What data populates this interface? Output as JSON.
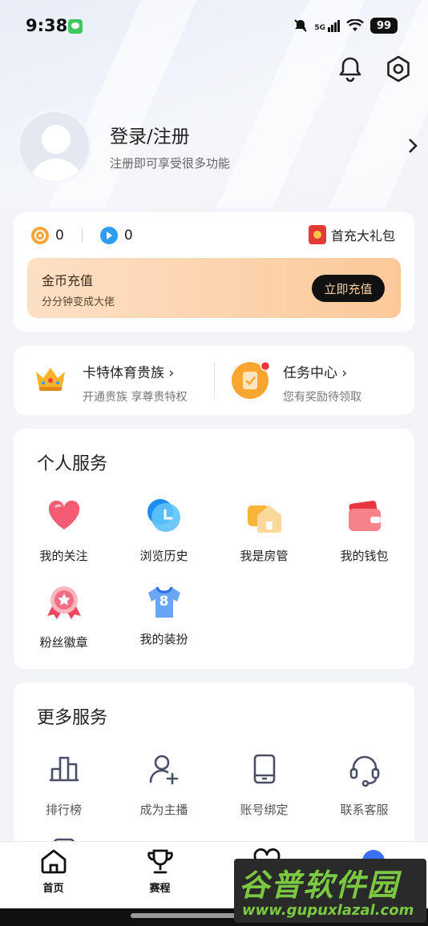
{
  "status_bar": {
    "time": "9:38",
    "network": "5G",
    "battery": "99"
  },
  "profile": {
    "title": "登录/注册",
    "subtitle": "注册即可享受很多功能"
  },
  "wallet": {
    "coin1_value": "0",
    "coin2_value": "0",
    "gift_label": "首充大礼包",
    "recharge_title": "金币充值",
    "recharge_sub": "分分钟变成大佬",
    "recharge_button": "立即充值"
  },
  "promo": {
    "noble_title": "卡特体育贵族 ›",
    "noble_sub": "开通贵族 享尊贵特权",
    "task_title": "任务中心 ›",
    "task_sub": "您有奖励待领取"
  },
  "personal_services": {
    "title": "个人服务",
    "items": [
      {
        "label": "我的关注",
        "icon": "heart-icon"
      },
      {
        "label": "浏览历史",
        "icon": "clock-icon"
      },
      {
        "label": "我是房管",
        "icon": "house-icon"
      },
      {
        "label": "我的钱包",
        "icon": "wallet-icon"
      },
      {
        "label": "粉丝徽章",
        "icon": "badge-icon"
      },
      {
        "label": "我的装扮",
        "icon": "jersey-icon"
      }
    ],
    "jersey_number": "8"
  },
  "more_services": {
    "title": "更多服务",
    "items": [
      {
        "label": "排行榜",
        "icon": "ranking-icon"
      },
      {
        "label": "成为主播",
        "icon": "add-user-icon"
      },
      {
        "label": "账号绑定",
        "icon": "phone-icon"
      },
      {
        "label": "联系客服",
        "icon": "headset-icon"
      }
    ]
  },
  "tabbar": {
    "tabs": [
      {
        "label": "首页",
        "icon": "home-icon"
      },
      {
        "label": "赛程",
        "icon": "trophy-icon"
      },
      {
        "label": "",
        "icon": "heart-outline-icon"
      },
      {
        "label": "",
        "icon": "profile-icon"
      }
    ]
  },
  "watermark": {
    "title": "谷普软件园",
    "url": "www.gupuxlazal.com"
  },
  "colors": {
    "accent": "#f7a43a",
    "recharge_start": "#fde0c5",
    "recharge_end": "#fcc99a",
    "button_bg": "#111111",
    "button_text": "#f7cfa3"
  }
}
